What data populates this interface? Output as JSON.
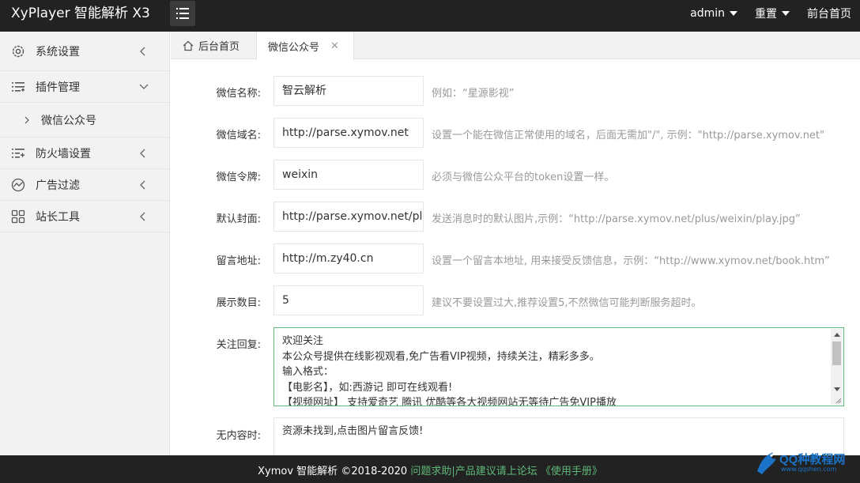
{
  "header": {
    "brand": "XyPlayer 智能解析 X3",
    "user": "admin",
    "reset": "重置",
    "frontpage": "前台首页"
  },
  "sidebar": {
    "items": [
      {
        "label": "系统设置",
        "icon": "gear-icon"
      },
      {
        "label": "插件管理",
        "icon": "list-icon"
      },
      {
        "label": "防火墙设置",
        "icon": "list-add-icon"
      },
      {
        "label": "广告过滤",
        "icon": "chart-icon"
      },
      {
        "label": "站长工具",
        "icon": "grid-icon"
      }
    ],
    "sub_item": "微信公众号"
  },
  "tabs": {
    "home": "后台首页",
    "active": "微信公众号",
    "close": "✕"
  },
  "form": {
    "name": {
      "label": "微信名称:",
      "value": "智云解析",
      "hint": "例如：“星源影视”"
    },
    "domain": {
      "label": "微信域名:",
      "value": "http://parse.xymov.net",
      "hint": "设置一个能在微信正常使用的域名，后面无需加\"/\", 示例：\"http://parse.xymov.net\""
    },
    "token": {
      "label": "微信令牌:",
      "value": "weixin",
      "hint": "必须与微信公众平台的token设置一样。"
    },
    "cover": {
      "label": "默认封面:",
      "value": "http://parse.xymov.net/plus/weixin/play.jpg",
      "hint": "发送消息时的默认图片,示例：“http://parse.xymov.net/plus/weixin/play.jpg”"
    },
    "message": {
      "label": "留言地址:",
      "value": "http://m.zy40.cn",
      "hint": "设置一个留言本地址, 用来接受反馈信息，示例：“http://www.xymov.net/book.htm”"
    },
    "count": {
      "label": "展示数目:",
      "value": "5",
      "hint": "建议不要设置过大,推荐设置5,不然微信可能判断服务超时。"
    },
    "follow": {
      "label": "关注回复:",
      "lines": [
        "欢迎关注",
        "本公众号提供在线影视观看,免广告看VIP视频，持续关注，精彩多多。",
        "输入格式：",
        "【电影名】，如:西游记 即可在线观看!",
        "【视频网址】 支持爱奇艺 腾讯 优酷等各大视频网站无等待广告免VIP播放"
      ]
    },
    "nocontent": {
      "label": "无内容时:",
      "value": "资源未找到,点击图片留言反馈!"
    }
  },
  "footer": {
    "copyright": "Xymov 智能解析 ©2018-2020",
    "links": "问题求助|产品建议请上论坛 《使用手册》"
  },
  "watermark": {
    "title": "QQ种教程网",
    "url": "www.qqshen.com"
  },
  "colors": {
    "topbar": "#222222",
    "accent": "#5fb878",
    "sidebar_bg": "#f2f2f2"
  }
}
